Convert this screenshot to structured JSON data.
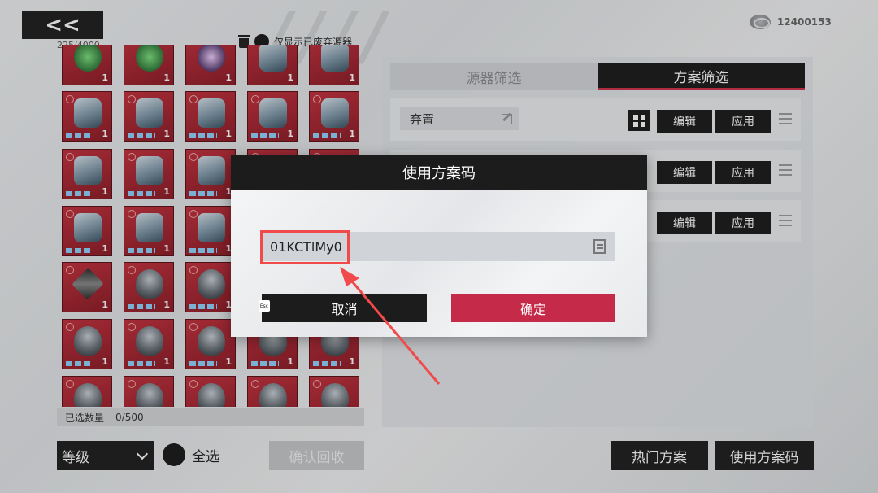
{
  "header": {
    "back_label": "<<",
    "inventory_count": "225/4000",
    "discard_filter_label": "仅显示已废弃源器",
    "currency_amount": "12400153"
  },
  "grid": {
    "quantities": [
      "1",
      "1",
      "1",
      "1",
      "1"
    ]
  },
  "footer_left": {
    "selected_label": "已选数量",
    "selected_count": "0/500",
    "sort_label": "等级",
    "select_all_label": "全选",
    "confirm_recycle_label": "确认回收"
  },
  "right": {
    "tabs": [
      {
        "label": "源器筛选",
        "active": false
      },
      {
        "label": "方案筛选",
        "active": true
      }
    ],
    "plans": [
      {
        "name": "弃置",
        "edit_label": "编辑",
        "apply_label": "应用"
      },
      {
        "edit_label": "编辑",
        "apply_label": "应用"
      },
      {
        "edit_label": "编辑",
        "apply_label": "应用"
      }
    ],
    "hot_plans_label": "热门方案",
    "use_plan_code_label": "使用方案码"
  },
  "modal": {
    "title": "使用方案码",
    "code_value": "01KCTlMy0",
    "esc_label": "Esc",
    "cancel_label": "取消",
    "confirm_label": "确定"
  },
  "colors": {
    "accent_red": "#c52a48",
    "highlight": "#f04a4a",
    "dark": "#1c1c1c"
  }
}
